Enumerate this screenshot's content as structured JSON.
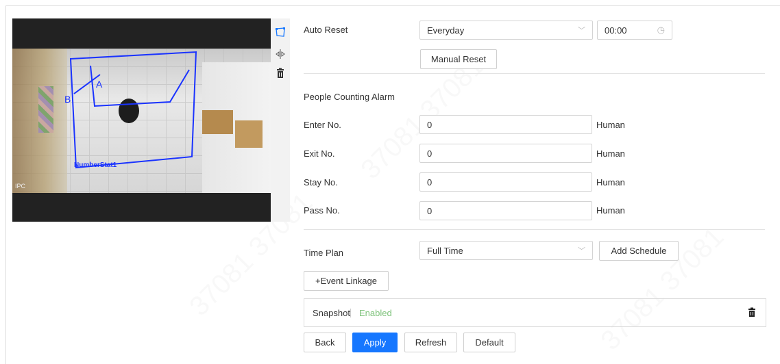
{
  "video": {
    "rule_name": "NumberStat1",
    "line_label_a": "A",
    "line_label_b": "B",
    "osd": "IPC"
  },
  "toolbar": {
    "icons": [
      "draw-area-icon",
      "resize-icon",
      "delete-icon"
    ]
  },
  "form": {
    "auto_reset": {
      "label": "Auto Reset",
      "period": "Everyday",
      "time": "00:00",
      "manual_reset_label": "Manual Reset"
    },
    "alarm_section": {
      "title": "People Counting Alarm"
    },
    "thresholds": [
      {
        "label": "Enter No.",
        "value": "0",
        "unit": "Human"
      },
      {
        "label": "Exit No.",
        "value": "0",
        "unit": "Human"
      },
      {
        "label": "Stay No.",
        "value": "0",
        "unit": "Human"
      },
      {
        "label": "Pass No.",
        "value": "0",
        "unit": "Human"
      }
    ],
    "time_plan": {
      "label": "Time Plan",
      "value": "Full Time",
      "add_schedule_label": "Add Schedule"
    },
    "event_linkage_label": "+Event Linkage",
    "linkage": {
      "name": "Snapshot",
      "status": "Enabled"
    }
  },
  "actions": {
    "back": "Back",
    "apply": "Apply",
    "refresh": "Refresh",
    "default": "Default"
  },
  "colors": {
    "primary": "#1677ff",
    "enabled": "#7dc27a",
    "overlay": "#1a33ff",
    "tool_active": "#1677ff"
  }
}
